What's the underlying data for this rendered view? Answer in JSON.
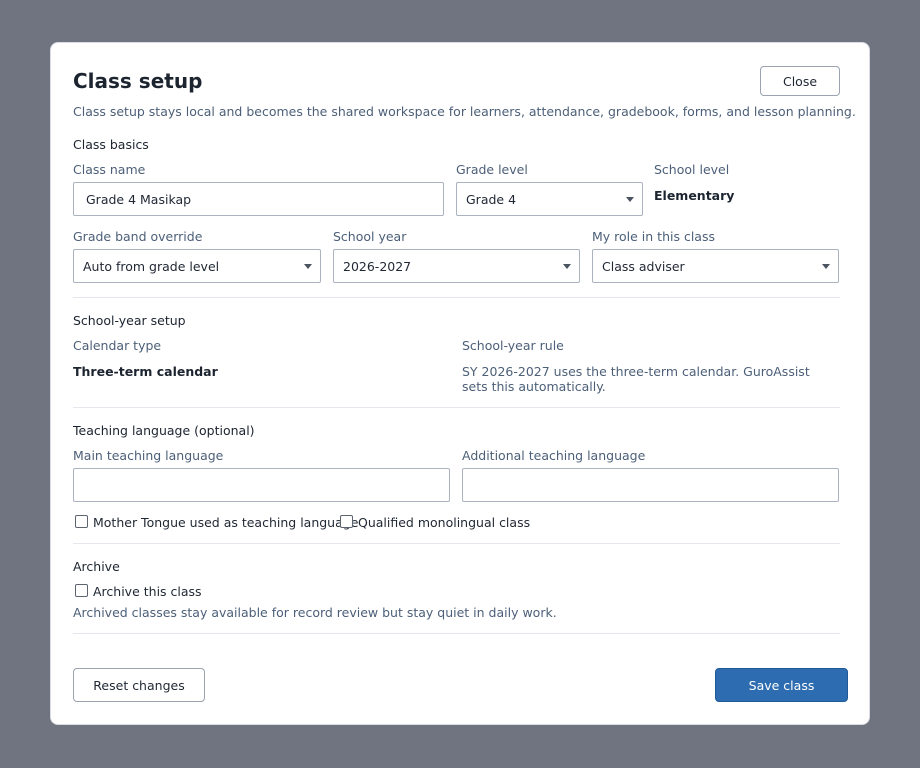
{
  "dialog": {
    "title": "Class setup",
    "close_label": "Close",
    "subtitle": "Class setup stays local and becomes the shared workspace for learners, attendance, gradebook, forms, and lesson planning."
  },
  "class_basics": {
    "section_title": "Class basics",
    "class_name_label": "Class name",
    "class_name_value": "Grade 4 Masikap",
    "grade_level_label": "Grade level",
    "grade_level_value": "Grade 4",
    "school_level_label": "School level",
    "school_level_value": "Elementary",
    "grade_band_label": "Grade band override",
    "grade_band_value": "Auto from grade level",
    "school_year_label": "School year",
    "school_year_value": "2026-2027",
    "role_label": "My role in this class",
    "role_value": "Class adviser"
  },
  "school_year_setup": {
    "section_title": "School-year setup",
    "calendar_type_label": "Calendar type",
    "calendar_type_value": "Three-term calendar",
    "rule_label": "School-year rule",
    "rule_text": "SY 2026-2027 uses the three-term calendar. GuroAssist sets this automatically."
  },
  "teaching_language": {
    "section_title": "Teaching language (optional)",
    "main_label": "Main teaching language",
    "main_value": "",
    "additional_label": "Additional teaching language",
    "additional_value": "",
    "mother_tongue_label": "Mother Tongue used as teaching language",
    "mother_tongue_checked": false,
    "monolingual_label": "Qualified monolingual class",
    "monolingual_checked": false
  },
  "archive": {
    "section_title": "Archive",
    "archive_label": "Archive this class",
    "archive_checked": false,
    "help_text": "Archived classes stay available for record review but stay quiet in daily work."
  },
  "footer": {
    "reset_label": "Reset changes",
    "save_label": "Save class"
  },
  "colors": {
    "backdrop": "#6f7480",
    "primary": "#2d6cb0",
    "muted_text": "#4c5f78"
  }
}
